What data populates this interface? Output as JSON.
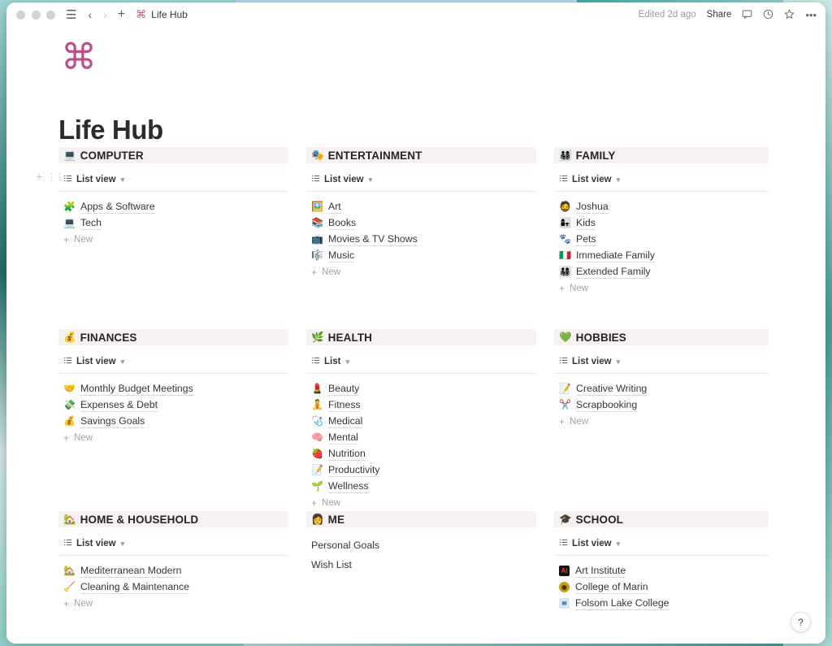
{
  "titlebar": {
    "hamburger_icon": "hamburger-menu-icon",
    "back_icon": "chevron-left-icon",
    "forward_icon": "chevron-right-icon",
    "plus_icon": "plus-icon",
    "cmd_icon": "⌘",
    "breadcrumb": "Life Hub",
    "edited": "Edited 2d ago",
    "share": "Share",
    "comment_icon": "💬",
    "history_icon": "🕐",
    "star_icon": "☆",
    "more_icon": "•••"
  },
  "page": {
    "icon": "⌘",
    "title": "Life Hub",
    "icon_color": "#ba4d8a"
  },
  "help": {
    "label": "?"
  },
  "labels": {
    "new": "New",
    "plus": "+",
    "chevron": "⌄",
    "list_icon": "☰"
  },
  "sections": [
    {
      "name": "COMPUTER",
      "emoji": "💻",
      "view": "List view",
      "has_view_bar": true,
      "has_new": true,
      "items": [
        {
          "emoji": "🧩",
          "label": "Apps & Software"
        },
        {
          "emoji": "💻",
          "label": "Tech"
        }
      ]
    },
    {
      "name": "ENTERTAINMENT",
      "emoji": "🎭",
      "view": "List view",
      "has_view_bar": true,
      "has_new": true,
      "items": [
        {
          "emoji": "🖼️",
          "label": "Art"
        },
        {
          "emoji": "📚",
          "label": "Books"
        },
        {
          "emoji": "📺",
          "label": "Movies & TV Shows"
        },
        {
          "emoji": "🎼",
          "label": "Music"
        }
      ]
    },
    {
      "name": "FAMILY",
      "emoji": "👨‍👩‍👧‍👦",
      "view": "List view",
      "has_view_bar": true,
      "has_new": true,
      "items": [
        {
          "emoji": "🧔",
          "label": "Joshua"
        },
        {
          "emoji": "👩‍👧",
          "label": "Kids"
        },
        {
          "emoji": "🐾",
          "label": "Pets"
        },
        {
          "emoji": "🇮🇹",
          "label": "Immediate Family"
        },
        {
          "emoji": "👨‍👩‍👧‍👦",
          "label": "Extended Family"
        }
      ]
    },
    {
      "name": "FINANCES",
      "emoji": "💰",
      "view": "List view",
      "has_view_bar": true,
      "has_new": true,
      "items": [
        {
          "emoji": "🤝",
          "label": "Monthly Budget Meetings"
        },
        {
          "emoji": "💸",
          "label": "Expenses & Debt"
        },
        {
          "emoji": "💰",
          "label": "Savings Goals"
        }
      ]
    },
    {
      "name": "HEALTH",
      "emoji": "🌿",
      "view": "List",
      "has_view_bar": true,
      "has_new": true,
      "items": [
        {
          "emoji": "💄",
          "label": "Beauty"
        },
        {
          "emoji": "🧘",
          "label": "Fitness"
        },
        {
          "emoji": "🩺",
          "label": "Medical"
        },
        {
          "emoji": "🧠",
          "label": "Mental"
        },
        {
          "emoji": "🍓",
          "label": "Nutrition"
        },
        {
          "emoji": "📝",
          "label": "Productivity"
        },
        {
          "emoji": "🌱",
          "label": "Wellness"
        }
      ]
    },
    {
      "name": "HOBBIES",
      "emoji": "💚",
      "view": "List view",
      "has_view_bar": true,
      "has_new": true,
      "items": [
        {
          "emoji": "📝",
          "label": "Creative Writing"
        },
        {
          "emoji": "✂️",
          "label": "Scrapbooking"
        }
      ]
    },
    {
      "name": "HOME & HOUSEHOLD",
      "emoji": "🏡",
      "view": "List view",
      "has_view_bar": true,
      "has_new": true,
      "items": [
        {
          "emoji": "🏡",
          "label": "Mediterranean Modern"
        },
        {
          "emoji": "🧹",
          "label": "Cleaning & Maintenance"
        }
      ]
    },
    {
      "name": "ME",
      "emoji": "👩",
      "view": "",
      "has_view_bar": false,
      "has_new": false,
      "plain_items": [
        {
          "label": "Personal Goals"
        },
        {
          "label": "Wish List"
        }
      ],
      "items": []
    },
    {
      "name": "SCHOOL",
      "emoji": "🎓",
      "view": "List view",
      "has_view_bar": true,
      "has_new": false,
      "items": [
        {
          "badge": "AI",
          "badge_class": "badge-ai",
          "label": "Art Institute"
        },
        {
          "badge": "◉",
          "badge_class": "badge-com",
          "label": "College of Marin"
        },
        {
          "badge": "≋",
          "badge_class": "badge-fol",
          "label": "Folsom Lake College"
        }
      ]
    }
  ]
}
